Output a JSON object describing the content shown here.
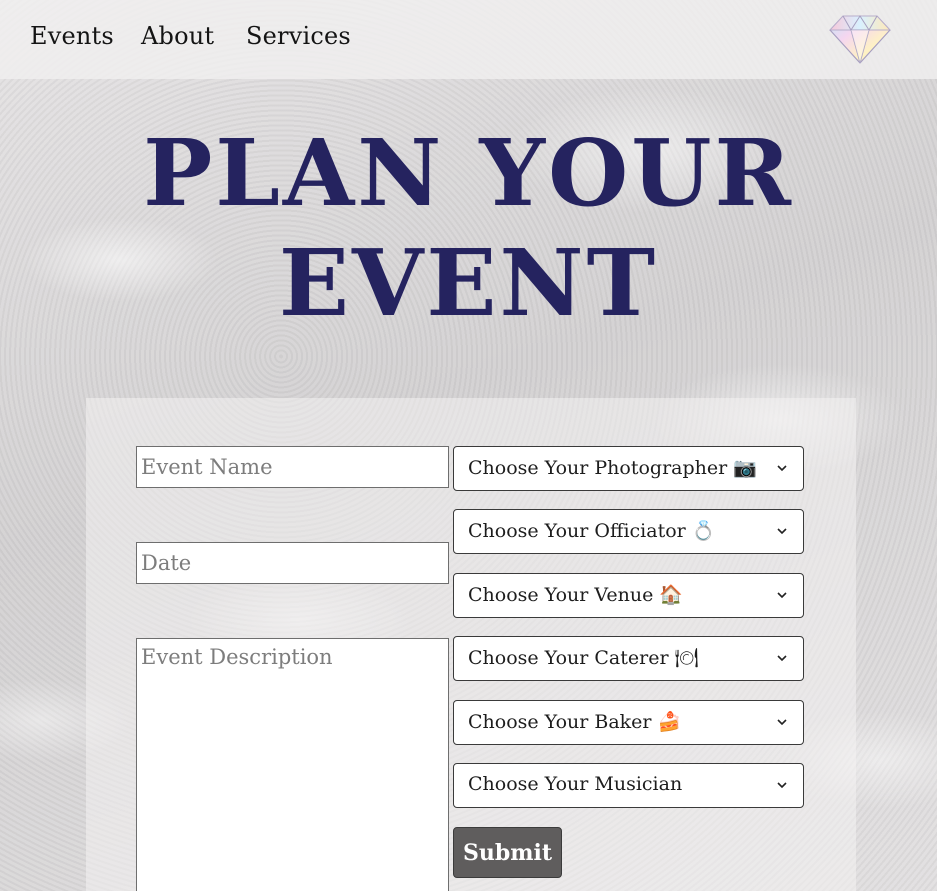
{
  "nav": {
    "items": [
      {
        "label": "Events"
      },
      {
        "label": "About"
      },
      {
        "label": "Services"
      }
    ],
    "logo_icon": "diamond-icon"
  },
  "hero": {
    "title": "Plan Your Event"
  },
  "form": {
    "event_name": {
      "value": "",
      "placeholder": "Event Name"
    },
    "date": {
      "value": "",
      "placeholder": "Date"
    },
    "description": {
      "value": "",
      "placeholder": "Event Description"
    },
    "selects": [
      {
        "label": "Choose Your Photographer 📷"
      },
      {
        "label": "Choose Your Officiator 💍"
      },
      {
        "label": "Choose Your Venue 🏠"
      },
      {
        "label": "Choose Your Caterer 🍽"
      },
      {
        "label": "Choose Your Baker 🍰"
      },
      {
        "label": "Choose Your Musician"
      }
    ],
    "submit_label": "Submit"
  },
  "colors": {
    "title": "#25235f",
    "button": "#5f5d5d",
    "nav_bar": "#f0efef"
  }
}
